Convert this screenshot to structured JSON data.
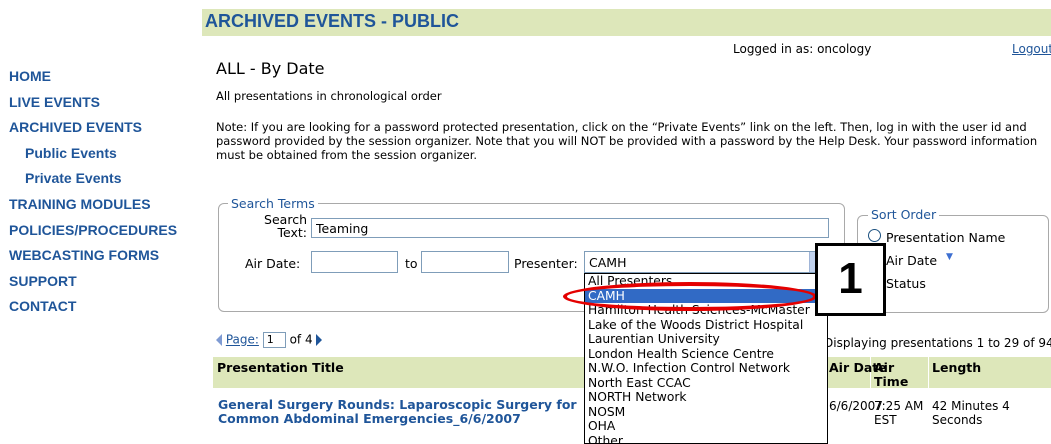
{
  "nav": {
    "items": [
      {
        "label": "HOME",
        "sub": false
      },
      {
        "label": "LIVE EVENTS",
        "sub": false
      },
      {
        "label": "ARCHIVED EVENTS",
        "sub": false
      },
      {
        "label": "Public Events",
        "sub": true
      },
      {
        "label": "Private Events",
        "sub": true
      },
      {
        "label": "TRAINING MODULES",
        "sub": false
      },
      {
        "label": "POLICIES/PROCEDURES",
        "sub": false
      },
      {
        "label": "WEBCASTING FORMS",
        "sub": false
      },
      {
        "label": "SUPPORT",
        "sub": false
      },
      {
        "label": "CONTACT",
        "sub": false
      }
    ]
  },
  "header": {
    "banner": "ARCHIVED EVENTS - PUBLIC",
    "login_text": "Logged in as: oncology",
    "logout_label": "Logout"
  },
  "main": {
    "title": "ALL - By Date",
    "subtitle": "All presentations in chronological order",
    "note": "Note: If you are looking for a password protected presentation, click on the “Private Events” link on the left. Then, log in with the user id and password provided by the session organizer. Note that you will NOT be provided with a password by the Help Desk. Your password information must be obtained from the session organizer."
  },
  "search": {
    "legend": "Search Terms",
    "search_text_label_line1": "Search",
    "search_text_label_line2": "Text:",
    "search_text_value": "Teaming",
    "air_date_label": "Air Date:",
    "to_label": "to",
    "air_date_from": "",
    "air_date_to": "",
    "presenter_label": "Presenter:",
    "presenter_selected": "CAMH",
    "presenter_options": [
      "All Presenters",
      "CAMH",
      "Hamilton Health Sciences-McMaster",
      "Lake of the Woods District Hospital",
      "Laurentian University",
      "London Health Science Centre",
      "N.W.O. Infection Control Network",
      "North East CCAC",
      "NORTH Network",
      "NOSM",
      "OHA",
      "Other"
    ],
    "highlighted_index": 1
  },
  "sort": {
    "legend": "Sort Order",
    "option_name": "Presentation Name",
    "option_date": "Air Date",
    "option_status": "Status"
  },
  "callout": {
    "label": "1"
  },
  "pagination": {
    "page_label": "Page:",
    "current_page": "1",
    "of_label": "of 4",
    "results_text": "Displaying presentations 1 to 29 of 94"
  },
  "table": {
    "headers": {
      "title": "Presentation Title",
      "date": "Air Date",
      "air_time_line1": "Air",
      "air_time_line2": "Time",
      "length": "Length"
    },
    "rows": [
      {
        "title_line1": "General Surgery Rounds: Laparoscopic Surgery for",
        "title_line2": "Common Abdominal Emergencies_6/6/2007",
        "date": "6/6/2007",
        "air_line1": "7:25 AM",
        "air_line2": "EST",
        "length_line1": "42 Minutes 4",
        "length_line2": "Seconds"
      }
    ]
  },
  "colors": {
    "accent": "#1f5599",
    "header_bg": "#dde7ba",
    "highlight": "#316ac5",
    "annotation": "#e40000"
  }
}
